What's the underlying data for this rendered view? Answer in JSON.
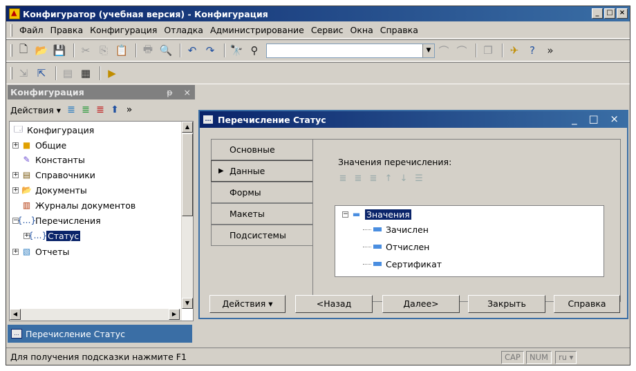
{
  "window": {
    "title": "Конфигуратор (учебная версия) - Конфигурация",
    "controls": {
      "minimize": "_",
      "maximize": "□",
      "close": "×"
    }
  },
  "menu": [
    "Файл",
    "Правка",
    "Конфигурация",
    "Отладка",
    "Администрирование",
    "Сервис",
    "Окна",
    "Справка"
  ],
  "toolbar": {
    "search_value": "",
    "overflow": "»"
  },
  "config_panel": {
    "title": "Конфигурация",
    "pin": "ᵽ",
    "close": "×",
    "actions_label": "Действия",
    "overflow": "»",
    "tree": [
      {
        "label": "Конфигурация",
        "icon": "config-icon"
      },
      {
        "label": "Общие",
        "icon": "common-icon"
      },
      {
        "label": "Константы",
        "icon": "constants-icon"
      },
      {
        "label": "Справочники",
        "icon": "catalogs-icon"
      },
      {
        "label": "Документы",
        "icon": "documents-icon"
      },
      {
        "label": "Журналы документов",
        "icon": "journals-icon"
      },
      {
        "label": "Перечисления",
        "icon": "enums-icon"
      },
      {
        "label": "Статус",
        "icon": "enum-item-icon"
      },
      {
        "label": "Отчеты",
        "icon": "reports-icon"
      }
    ]
  },
  "taskbar": {
    "tab_label": "Перечисление Статус",
    "tab_icon_text": "..."
  },
  "status": {
    "hint": "Для получения подсказки нажмите F1",
    "cap": "CAP",
    "num": "NUM",
    "lang": "ru"
  },
  "child": {
    "title": "Перечисление Статус",
    "icon_text": "...",
    "tabs": [
      "Основные",
      "Данные",
      "Формы",
      "Макеты",
      "Подсистемы"
    ],
    "active_tab": "Данные",
    "enum_label": "Значения перечисления:",
    "root": "Значения",
    "values": [
      "Зачислен",
      "Отчислен",
      "Сертификат"
    ],
    "buttons": {
      "actions": "Действия",
      "back": "<Назад",
      "next": "Далее>",
      "close": "Закрыть",
      "help": "Справка"
    }
  }
}
